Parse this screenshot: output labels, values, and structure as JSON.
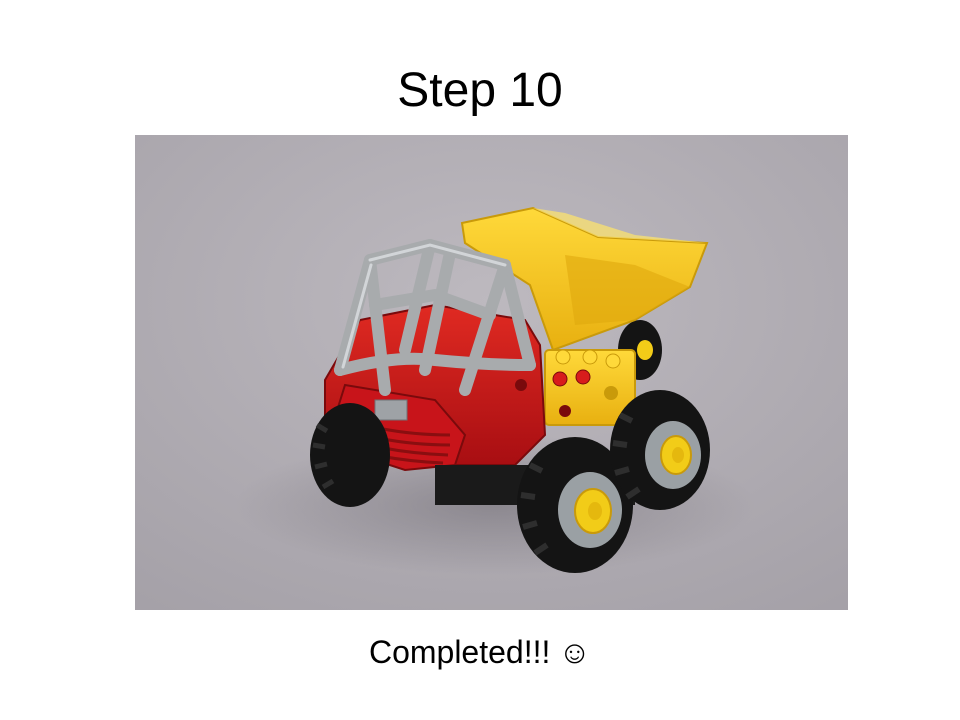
{
  "slide": {
    "title": "Step 10",
    "photo": {
      "alt": "Completed toy dump truck built from large plastic bricks",
      "background": "#b0acb2",
      "colors": {
        "tipper": "#f4c21c",
        "cab": "#c8141a",
        "roll_cage": "#a8abad",
        "tires": "#141414",
        "hubs": "#f2cc18"
      }
    },
    "caption": {
      "text": "Completed!!!",
      "emoji": "☺"
    }
  }
}
